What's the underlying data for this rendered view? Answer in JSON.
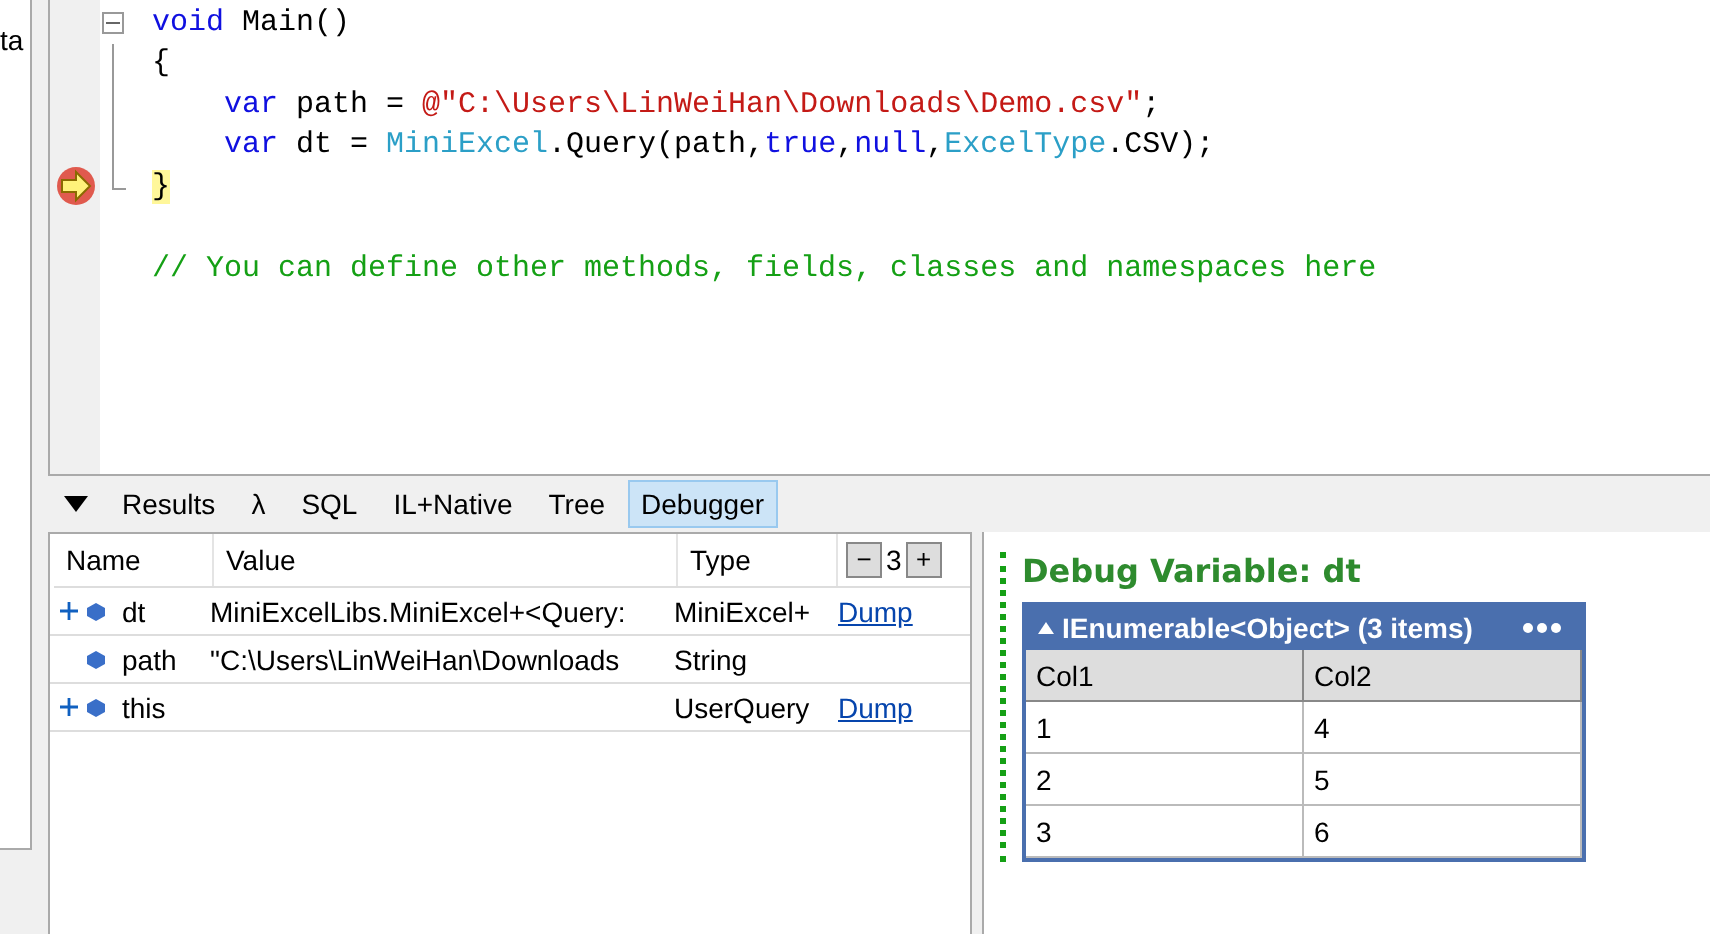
{
  "side_panel": {
    "text": "ta"
  },
  "editor": {
    "lines": [
      {
        "current": false,
        "tokens": [
          {
            "kind": "keyword",
            "text": "void"
          },
          {
            "kind": "plain",
            "text": " Main()"
          }
        ],
        "children": [
          {
            "current": false,
            "tokens": [
              {
                "kind": "plain",
                "text": "{"
              }
            ]
          },
          {
            "current": false,
            "tokens": [
              {
                "kind": "keyword",
                "text": "    var"
              },
              {
                "kind": "plain",
                "text": " path = "
              },
              {
                "kind": "string",
                "text": "@\"C:\\Users\\LinWeiHan\\Downloads\\Demo.csv\""
              },
              {
                "kind": "plain",
                "text": ";"
              }
            ]
          },
          {
            "current": false,
            "tokens": [
              {
                "kind": "keyword",
                "text": "    var"
              },
              {
                "kind": "plain",
                "text": " dt = "
              },
              {
                "kind": "type",
                "text": "MiniExcel"
              },
              {
                "kind": "plain",
                "text": ".Query(path,"
              },
              {
                "kind": "keyword",
                "text": "true"
              },
              {
                "kind": "plain",
                "text": ","
              },
              {
                "kind": "keyword",
                "text": "null"
              },
              {
                "kind": "plain",
                "text": ","
              },
              {
                "kind": "type",
                "text": "ExcelType"
              },
              {
                "kind": "plain",
                "text": ".CSV);"
              }
            ]
          },
          {
            "current": true,
            "tokens": [
              {
                "kind": "plain",
                "text": "}"
              }
            ]
          }
        ]
      },
      {
        "current": false,
        "tokens": [
          {
            "kind": "comment",
            "text": "// You can define other methods, fields, classes and namespaces here"
          }
        ]
      }
    ]
  },
  "tabs": [
    {
      "label": "Results",
      "selected": false
    },
    {
      "label": "λ",
      "selected": false
    },
    {
      "label": "SQL",
      "selected": false
    },
    {
      "label": "IL+Native",
      "selected": false
    },
    {
      "label": "Tree",
      "selected": false
    },
    {
      "label": "Debugger",
      "selected": true
    }
  ],
  "locals": {
    "columns": [
      "Name",
      "Value",
      "Type"
    ],
    "depth_minus": "−",
    "depth": "3",
    "depth_plus": "+",
    "rows": [
      {
        "expandable": true,
        "name": "dt",
        "value": "MiniExcelLibs.MiniExcel+<Query:",
        "type": "MiniExcel+",
        "link": "Dump"
      },
      {
        "expandable": false,
        "name": "path",
        "value": "\"C:\\Users\\LinWeiHan\\Downloads",
        "type": "String"
      },
      {
        "expandable": true,
        "name": "this",
        "type": "UserQuery",
        "link": "Dump"
      }
    ]
  },
  "debug_view": {
    "heading": "Debug Variable: dt",
    "table_title": "IEnumerable<Object> (3 items)",
    "columns": [
      "Col1",
      "Col2"
    ],
    "rows": [
      [
        "1",
        "4"
      ],
      [
        "2",
        "5"
      ],
      [
        "3",
        "6"
      ]
    ]
  }
}
